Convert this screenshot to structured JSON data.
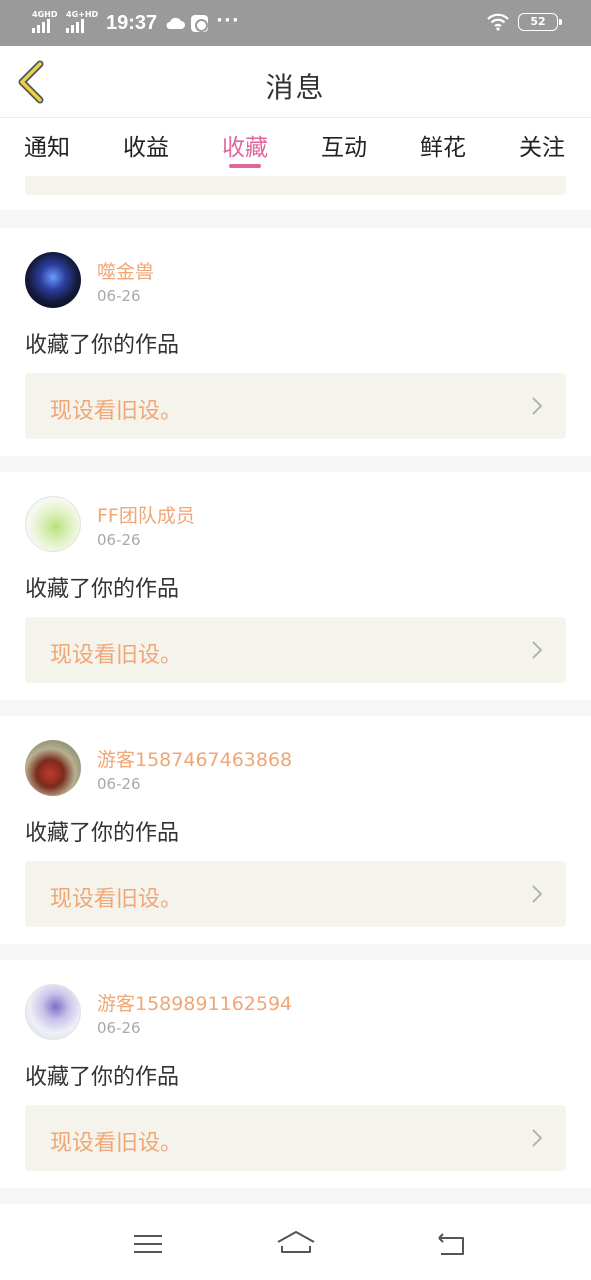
{
  "status_bar": {
    "signal1": "4GHD",
    "signal2": "4G+HD",
    "time": "19:37",
    "dots": "···",
    "battery": "52"
  },
  "header": {
    "title": "消息"
  },
  "tabs": [
    {
      "label": "通知",
      "active": false
    },
    {
      "label": "收益",
      "active": false
    },
    {
      "label": "收藏",
      "active": true
    },
    {
      "label": "互动",
      "active": false
    },
    {
      "label": "鲜花",
      "active": false
    },
    {
      "label": "关注",
      "active": false
    }
  ],
  "feed": [
    {
      "username": "噬金兽",
      "date": "06-26",
      "action": "收藏了你的作品",
      "work_title": "现设看旧设。"
    },
    {
      "username": "FF团队成员",
      "date": "06-26",
      "action": "收藏了你的作品",
      "work_title": "现设看旧设。"
    },
    {
      "username": "游客1587467463868",
      "date": "06-26",
      "action": "收藏了你的作品",
      "work_title": "现设看旧设。"
    },
    {
      "username": "游客1589891162594",
      "date": "06-26",
      "action": "收藏了你的作品",
      "work_title": "现设看旧设。"
    }
  ],
  "colors": {
    "accent": "#e0679e",
    "username": "#f0a675",
    "work_title": "#f0a675",
    "work_bg": "#f5f4ec",
    "status_bar": "#9a9a9a",
    "back_arrow": "#e8d24a"
  },
  "icons": {
    "back": "chevron-left-icon",
    "cloud": "cloud-icon",
    "play": "play-app-icon",
    "wifi": "wifi-icon",
    "battery": "battery-icon",
    "work_arrow": "chevron-right-icon",
    "nav_menu": "menu-icon",
    "nav_home": "home-icon",
    "nav_back": "return-icon"
  }
}
